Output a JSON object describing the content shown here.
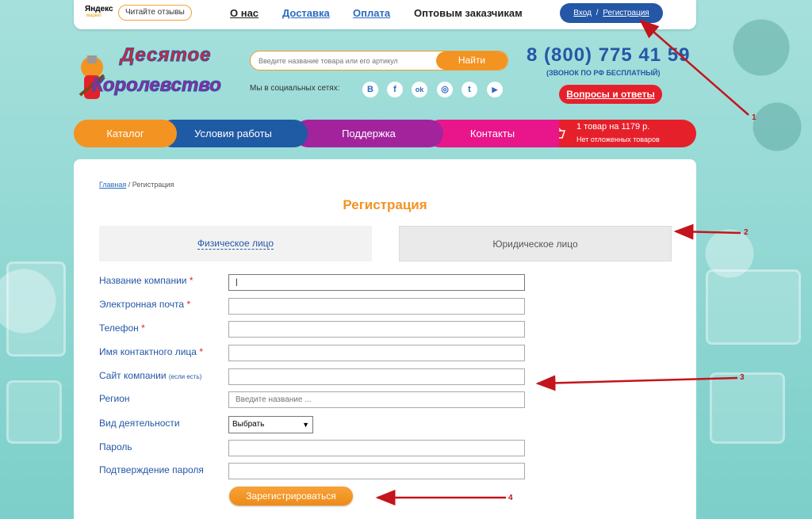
{
  "topbar": {
    "yandex_logo_text": "Яндекс",
    "yandex_market_text": "маркет",
    "reviews_label": "Читайте отзывы",
    "nav": [
      "О нас",
      "Доставка",
      "Оплата",
      "Оптовым заказчикам"
    ],
    "login_label": "Вход",
    "separator": "/",
    "register_label": "Регистрация"
  },
  "header": {
    "logo_line1": "Десятое",
    "logo_line2": "Королевство",
    "search_placeholder": "Введите название товара или его артикул",
    "search_button": "Найти",
    "social_label": "Мы в социальных сетях:",
    "social_icons": [
      "В",
      "f",
      "ok",
      "◎",
      "t",
      "▶"
    ],
    "phone": "8 (800) 775 41 59",
    "phone_note": "(ЗВОНОК ПО РФ БЕСПЛАТНЫЙ)",
    "faq_button": "Вопросы и ответы"
  },
  "mainnav": {
    "items": [
      "Каталог",
      "Условия работы",
      "Поддержка",
      "Контакты"
    ],
    "colors": [
      "#f39322",
      "#1f5aa5",
      "#a2239c",
      "#e9158a"
    ]
  },
  "cart": {
    "line1": "1 товар на 1179 р.",
    "line2": "Нет отложенных товаров"
  },
  "content": {
    "breadcrumb_home": "Главная",
    "breadcrumb_sep": " / ",
    "breadcrumb_current": "Регистрация",
    "title": "Регистрация",
    "tab_individual": "Физическое лицо",
    "tab_legal": "Юридическое лицо",
    "fields": {
      "company": "Название компании",
      "email": "Электронная почта",
      "phone": "Телефон",
      "contact": "Имя контактного лица",
      "site": "Сайт компании",
      "site_note": "(если есть)",
      "region": "Регион",
      "activity": "Вид деятельности",
      "password": "Пароль",
      "password_confirm": "Подтверждение пароля"
    },
    "required_mark": "*",
    "company_value": "|",
    "region_placeholder": "Введите название ...",
    "activity_selected": "Выбрать",
    "submit": "Зарегистрироваться"
  },
  "annotations": [
    "1",
    "2",
    "3",
    "4"
  ],
  "colors": {
    "accent_orange": "#f39322",
    "brand_blue": "#2457a6",
    "alert_red": "#e5202b",
    "annotation_red": "#c4141c"
  }
}
